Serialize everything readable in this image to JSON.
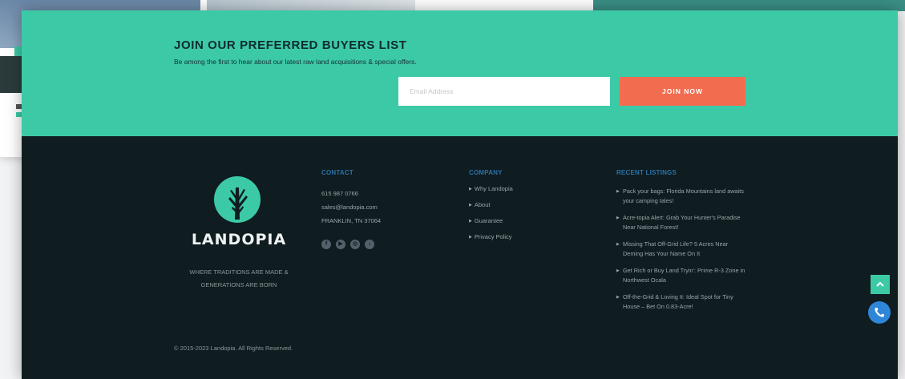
{
  "newsletter": {
    "title": "JOIN OUR PREFERRED BUYERS LIST",
    "subtitle": "Be among the first to hear about our latest raw land acquisitions & special offers.",
    "email_placeholder": "Email Address",
    "email_value": "",
    "button_label": "JOIN NOW"
  },
  "brand": {
    "name": "LANDOPIA",
    "tagline": "WHERE TRADITIONS ARE MADE & GENERATIONS ARE BORN",
    "logo_icon": "tree-icon"
  },
  "contact": {
    "heading": "CONTACT",
    "phone": "615 987 0766",
    "email": "sales@landopia.com",
    "location": "FRANKLIN, TN 37064",
    "social": [
      {
        "icon": "facebook-icon",
        "glyph": "f"
      },
      {
        "icon": "youtube-icon",
        "glyph": "▶"
      },
      {
        "icon": "instagram-icon",
        "glyph": "◎"
      },
      {
        "icon": "tiktok-icon",
        "glyph": "♪"
      }
    ]
  },
  "company": {
    "heading": "COMPANY",
    "links": [
      "Why Landopia",
      "About",
      "Guarantee",
      "Privacy Policy"
    ]
  },
  "recent": {
    "heading": "RECENT LISTINGS",
    "items": [
      "Pack your bags: Florida Mountains land awaits your camping tales!",
      "Acre-topia Alert: Grab Your Hunter's Paradise Near National Forest!",
      "Missing That Off-Grid Life? 5 Acres Near Deming Has Your Name On It",
      "Get Rich or Buy Land Tryin': Prime R-3 Zone in Northwest Ocala",
      "Off-the-Grid & Loving It: Ideal Spot for Tiny House – Bet On 0.83-Acre!"
    ]
  },
  "copyright": "© 2015-2023 Landopia. All Rights Reserved.",
  "floating": {
    "scroll_top_icon": "chevron-up-icon",
    "phone_icon": "phone-icon"
  },
  "colors": {
    "accent_green": "#3cc9a6",
    "footer_dark": "#0f1c20",
    "cta_orange": "#f26d4f",
    "heading_blue": "#2b71a8",
    "phone_blue": "#2f86d8"
  }
}
